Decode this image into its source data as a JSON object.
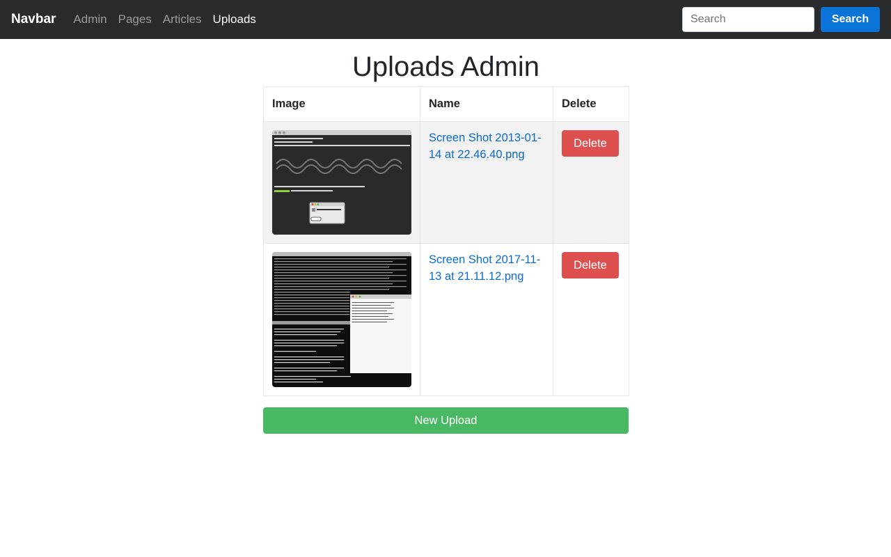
{
  "navbar": {
    "brand": "Navbar",
    "links": [
      {
        "label": "Admin",
        "active": false
      },
      {
        "label": "Pages",
        "active": false
      },
      {
        "label": "Articles",
        "active": false
      },
      {
        "label": "Uploads",
        "active": true
      }
    ],
    "search_placeholder": "Search",
    "search_button": "Search"
  },
  "page": {
    "title": "Uploads Admin"
  },
  "table": {
    "headers": [
      "Image",
      "Name",
      "Delete"
    ],
    "rows": [
      {
        "name": "Screen Shot 2013-01-14 at 22.46.40.png",
        "delete_label": "Delete"
      },
      {
        "name": "Screen Shot 2017-11-13 at 21.11.12.png",
        "delete_label": "Delete"
      }
    ]
  },
  "new_upload_label": "New Upload",
  "colors": {
    "navbar_bg": "#2a2b2d",
    "search_button": "#0a73d8",
    "delete_button": "#de4f50",
    "new_upload_button": "#49b862",
    "link": "#0b6bd0"
  }
}
